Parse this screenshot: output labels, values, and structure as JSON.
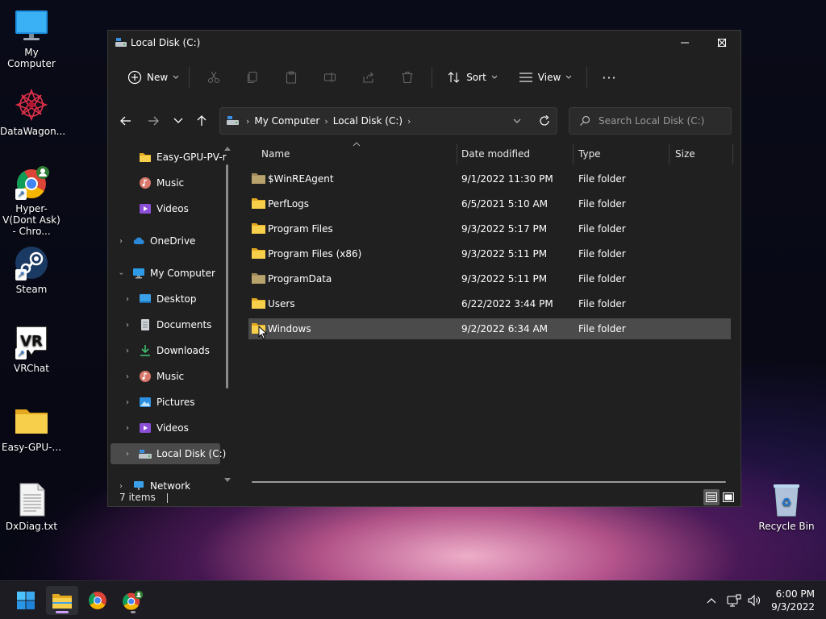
{
  "desktop": {
    "icons": [
      {
        "label": "My Computer"
      },
      {
        "label": "DataWagon..."
      },
      {
        "label": "Hyper-V(Dont Ask) - Chro..."
      },
      {
        "label": "Steam"
      },
      {
        "label": "VRChat"
      },
      {
        "label": "Easy-GPU-..."
      },
      {
        "label": "DxDiag.txt"
      },
      {
        "label": "Recycle Bin"
      }
    ],
    "vrchat_logo_text": "VR"
  },
  "window": {
    "title": "Local Disk (C:)",
    "commandbar": {
      "new_label": "New",
      "sort_label": "Sort",
      "view_label": "View",
      "more_label": "···"
    },
    "address": {
      "crumbs": [
        "My Computer",
        "Local Disk (C:)"
      ],
      "search_placeholder": "Search Local Disk (C:)"
    },
    "nav": [
      {
        "label": "Easy-GPU-PV-r"
      },
      {
        "label": "Music"
      },
      {
        "label": "Videos"
      },
      {
        "label": "OneDrive"
      },
      {
        "label": "My Computer"
      },
      {
        "label": "Desktop"
      },
      {
        "label": "Documents"
      },
      {
        "label": "Downloads"
      },
      {
        "label": "Music"
      },
      {
        "label": "Pictures"
      },
      {
        "label": "Videos"
      },
      {
        "label": "Local Disk (C:)"
      },
      {
        "label": "Network"
      }
    ],
    "columns": {
      "name": "Name",
      "date": "Date modified",
      "type": "Type",
      "size": "Size"
    },
    "files": [
      {
        "name": "$WinREAgent",
        "date": "9/1/2022 11:30 PM",
        "type": "File folder"
      },
      {
        "name": "PerfLogs",
        "date": "6/5/2021 5:10 AM",
        "type": "File folder"
      },
      {
        "name": "Program Files",
        "date": "9/3/2022 5:17 PM",
        "type": "File folder"
      },
      {
        "name": "Program Files (x86)",
        "date": "9/3/2022 5:11 PM",
        "type": "File folder"
      },
      {
        "name": "ProgramData",
        "date": "9/3/2022 5:11 PM",
        "type": "File folder"
      },
      {
        "name": "Users",
        "date": "6/22/2022 3:44 PM",
        "type": "File folder"
      },
      {
        "name": "Windows",
        "date": "9/2/2022 6:34 AM",
        "type": "File folder"
      }
    ],
    "status": {
      "items_count": "7 items"
    }
  },
  "taskbar": {
    "clock_time": "6:00 PM",
    "clock_date": "9/3/2022"
  },
  "colors": {
    "accent": "#0078d4",
    "folder_yellow": "#f5c242",
    "selection": "#4b4b4b"
  }
}
